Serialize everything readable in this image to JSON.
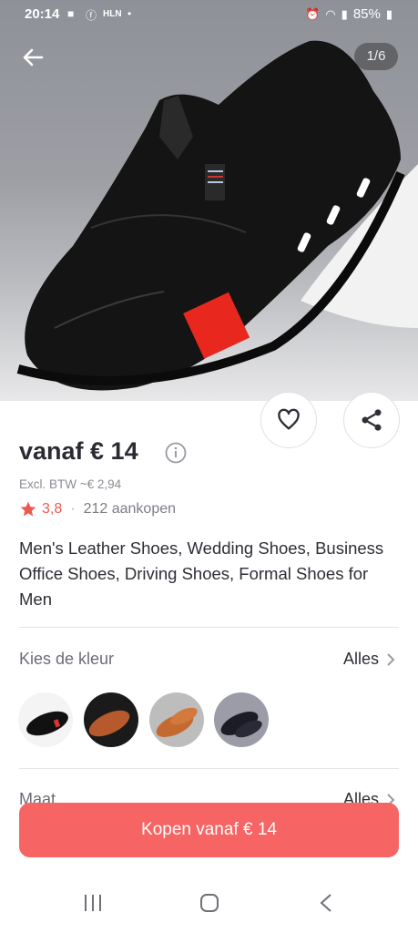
{
  "status": {
    "time": "20:14",
    "app_badge": "HLN",
    "battery": "85%"
  },
  "gallery": {
    "counter": "1/6"
  },
  "product": {
    "price": "vanaf € 14",
    "vat": "Excl. BTW ~€ 2,94",
    "rating": "3,8",
    "purchases": "212 aankopen",
    "title": "Men's Leather Shoes, Wedding Shoes, Business Office Shoes, Driving Shoes, Formal Shoes for Men"
  },
  "color_section": {
    "label": "Kies de kleur",
    "all_label": "Alles"
  },
  "size_section": {
    "label": "Maat",
    "all_label": "Alles"
  },
  "buy_button": {
    "label": "Kopen vanaf € 14"
  },
  "colors": {
    "accent": "#f66464",
    "rating": "#ed5a4d"
  },
  "icons": [
    "arrow-left-icon",
    "heart-icon",
    "share-icon",
    "info-icon",
    "star-icon",
    "chevron-right-icon",
    "recent-apps-icon",
    "home-icon",
    "back-icon"
  ]
}
